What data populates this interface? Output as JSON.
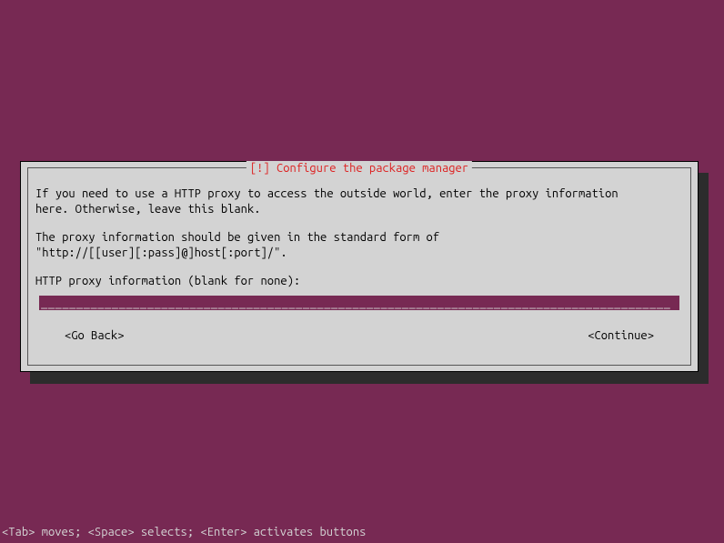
{
  "dialog": {
    "title": "[!] Configure the package manager",
    "para1": "If you need to use a HTTP proxy to access the outside world, enter the proxy information\nhere. Otherwise, leave this blank.",
    "para2": "The proxy information should be given in the standard form of\n\"http://[[user][:pass]@]host[:port]/\".",
    "prompt": "HTTP proxy information (blank for none):",
    "input_fill": "_________________________________________________________________________________________",
    "go_back": "<Go Back>",
    "continue": "<Continue>"
  },
  "status": "<Tab> moves; <Space> selects; <Enter> activates buttons"
}
